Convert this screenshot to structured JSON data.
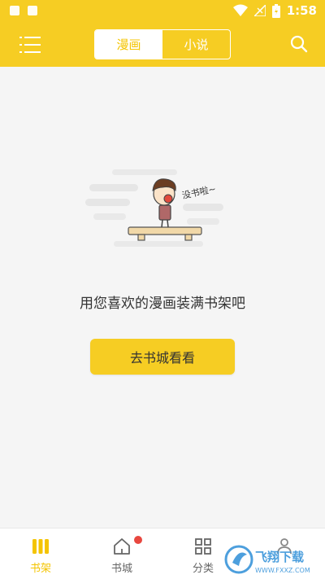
{
  "status_bar": {
    "time": "1:58"
  },
  "header": {
    "tabs": [
      {
        "label": "漫画",
        "active": true
      },
      {
        "label": "小说",
        "active": false
      }
    ]
  },
  "illustration": {
    "speech_text": "没书啦~"
  },
  "empty_state": {
    "message": "用您喜欢的漫画装满书架吧",
    "cta_label": "去书城看看"
  },
  "bottom_nav": {
    "items": [
      {
        "label": "书架",
        "icon": "bookshelf-icon",
        "active": true
      },
      {
        "label": "书城",
        "icon": "home-icon",
        "active": false,
        "badge": true
      },
      {
        "label": "分类",
        "icon": "grid-icon",
        "active": false
      },
      {
        "label": "",
        "icon": "profile-icon",
        "active": false
      }
    ]
  },
  "watermark": {
    "text": "飞翔下载",
    "sub": "WWW.FXXZ.COM"
  },
  "colors": {
    "accent": "#f6cd23",
    "accent_text": "#f4c400",
    "badge": "#e8473f"
  }
}
